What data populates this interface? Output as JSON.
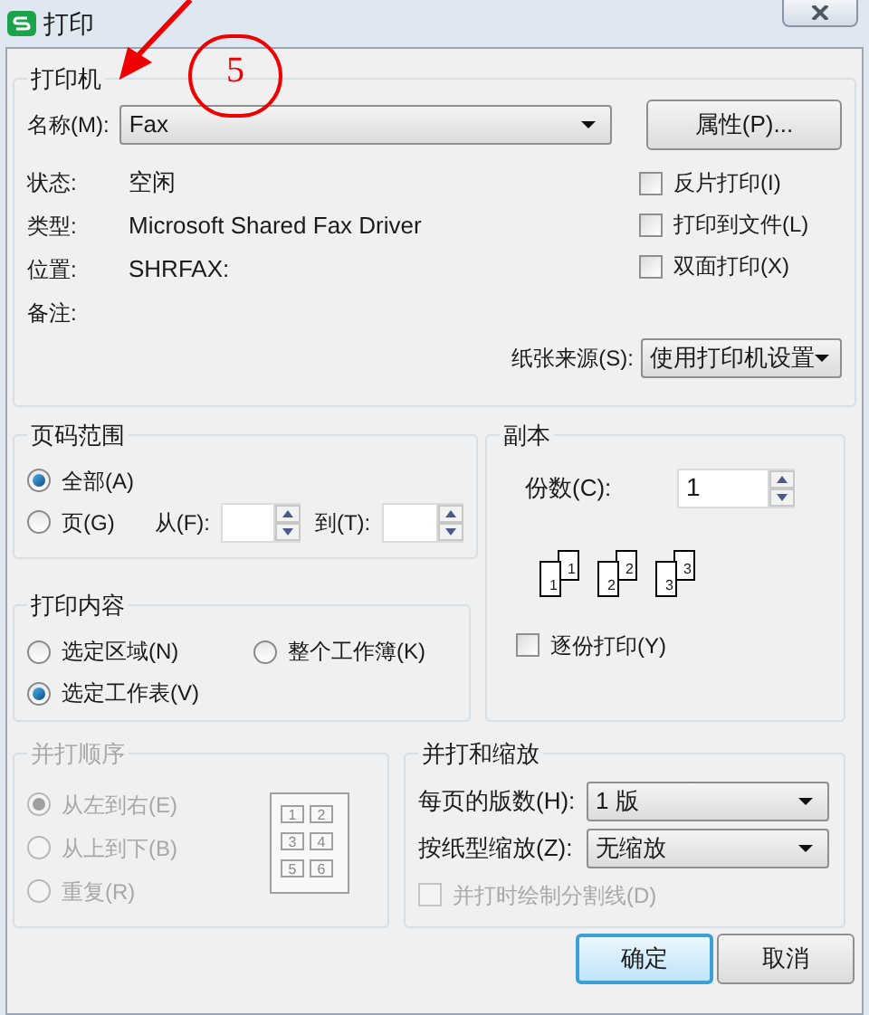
{
  "window": {
    "title": "打印"
  },
  "annotation": {
    "number": "5"
  },
  "printer": {
    "legend": "打印机",
    "name_label": "名称(M):",
    "name_value": "Fax",
    "properties_button": "属性(P)...",
    "info": [
      {
        "label": "状态:",
        "value": "空闲"
      },
      {
        "label": "类型:",
        "value": "Microsoft Shared Fax Driver"
      },
      {
        "label": "位置:",
        "value": "SHRFAX:"
      },
      {
        "label": "备注:"
      }
    ],
    "options": [
      {
        "label": "反片打印(I)",
        "checked": false
      },
      {
        "label": "打印到文件(L)",
        "checked": false
      },
      {
        "label": "双面打印(X)",
        "checked": false
      }
    ],
    "paper_source_label": "纸张来源(S):",
    "paper_source_value": "使用打印机设置"
  },
  "page_range": {
    "legend": "页码范围",
    "options": [
      {
        "label": "全部(A)",
        "selected": true
      },
      {
        "label": "页(G)",
        "selected": false
      }
    ],
    "from_label": "从(F):",
    "to_label": "到(T):"
  },
  "print_content": {
    "legend": "打印内容",
    "options": [
      {
        "label": "选定区域(N)",
        "selected": false
      },
      {
        "label": "整个工作簿(K)",
        "selected": false
      },
      {
        "label": "选定工作表(V)",
        "selected": true
      }
    ]
  },
  "copies": {
    "legend": "副本",
    "count_label": "份数(C):",
    "count_value": "1",
    "collate_pages": [
      {
        "back": "1",
        "front": "1"
      },
      {
        "back": "2",
        "front": "2"
      },
      {
        "back": "3",
        "front": "3"
      }
    ],
    "collate": {
      "label": "逐份打印(Y)",
      "checked": false
    }
  },
  "order": {
    "legend": "并打顺序",
    "disabled": true,
    "options": [
      {
        "label": "从左到右(E)",
        "selected": true
      },
      {
        "label": "从上到下(B)",
        "selected": false
      },
      {
        "label": "重复(R)",
        "selected": false
      }
    ],
    "preview_numbers": [
      "1",
      "2",
      "3",
      "4",
      "5",
      "6"
    ]
  },
  "scaling": {
    "legend": "并打和缩放",
    "pages_per_sheet_label": "每页的版数(H):",
    "pages_per_sheet_value": "1 版",
    "scale_label": "按纸型缩放(Z):",
    "scale_value": "无缩放",
    "draw_lines": {
      "label": "并打时绘制分割线(D)",
      "checked": false,
      "disabled": true
    }
  },
  "buttons": [
    {
      "label": "确定",
      "default": true
    },
    {
      "label": "取消",
      "default": false
    }
  ]
}
